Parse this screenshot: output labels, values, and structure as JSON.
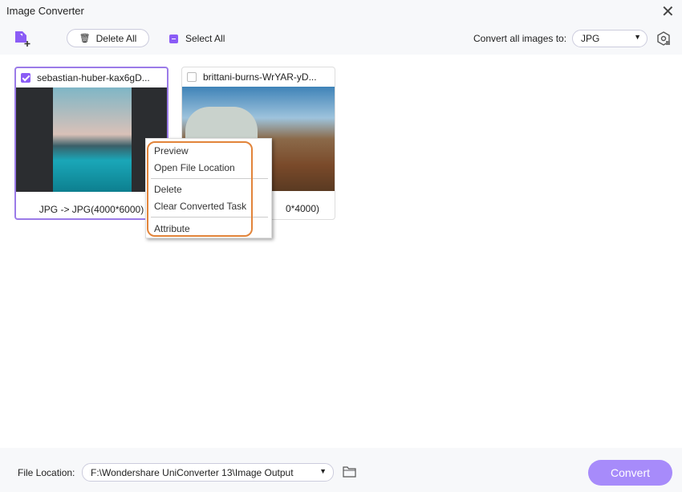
{
  "window": {
    "title": "Image Converter"
  },
  "toolbar": {
    "delete_all": "Delete All",
    "select_all": "Select All",
    "convert_all_label": "Convert all images to:",
    "format": "JPG"
  },
  "cards": [
    {
      "name": "sebastian-huber-kax6gD...",
      "caption": "JPG -> JPG(4000*6000)",
      "checked": true
    },
    {
      "name": "brittani-burns-WrYAR-yD...",
      "caption": "0*4000)",
      "checked": false
    }
  ],
  "context_menu": {
    "items": [
      "Preview",
      "Open File Location",
      "Delete",
      "Clear Converted Task",
      "Attribute"
    ]
  },
  "footer": {
    "file_location_label": "File Location:",
    "file_location": "F:\\Wondershare UniConverter 13\\Image Output",
    "convert": "Convert"
  },
  "colors": {
    "accent": "#8b5cf6",
    "highlight": "#e2843a"
  }
}
